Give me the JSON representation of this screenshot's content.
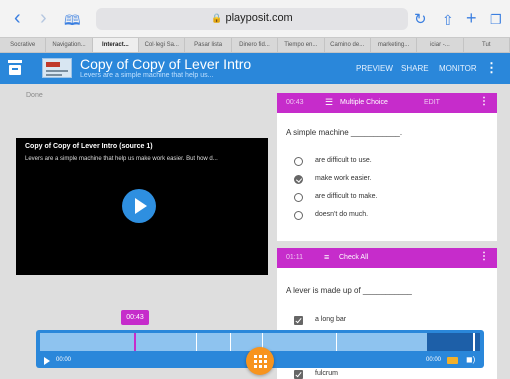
{
  "browser": {
    "url": "playposit.com",
    "tabs": [
      {
        "label": "Socrative",
        "active": false
      },
      {
        "label": "Navigation...",
        "active": false
      },
      {
        "label": "Interact...",
        "active": true
      },
      {
        "label": "Col·legi Sa...",
        "active": false
      },
      {
        "label": "Pasar lista",
        "active": false
      },
      {
        "label": "Dinero fid...",
        "active": false
      },
      {
        "label": "Tiempo en...",
        "active": false
      },
      {
        "label": "Camino de...",
        "active": false
      },
      {
        "label": "marketing...",
        "active": false
      },
      {
        "label": "iciar -...",
        "active": false
      },
      {
        "label": "Tut",
        "active": false
      }
    ]
  },
  "header": {
    "title": "Copy of Copy of Lever Intro",
    "subtitle": "Levers are a simple machine that help us...",
    "preview": "PREVIEW",
    "share": "SHARE",
    "monitor": "MONITOR",
    "accent": "#2a87da"
  },
  "main": {
    "done_label": "Done"
  },
  "video": {
    "title": "Copy of Copy of Lever Intro (source 1)",
    "description": "Levers are a simple machine that help us make work easier. But how d..."
  },
  "question1": {
    "time": "00:43",
    "type": "Multiple Choice",
    "edit": "EDIT",
    "prompt": "A simple machine ___________.",
    "options": [
      {
        "label": "are difficult to use.",
        "selected": false
      },
      {
        "label": "make work easier.",
        "selected": true
      },
      {
        "label": "are difficult to make.",
        "selected": false
      },
      {
        "label": "doesn't do much.",
        "selected": false
      }
    ]
  },
  "question2": {
    "time": "01:11",
    "type": "Check All",
    "prompt": "A lever is made up of ___________",
    "options": [
      {
        "label": "a long bar",
        "checked": true
      },
      {
        "label": "fulcrum",
        "checked": true
      }
    ]
  },
  "timeline": {
    "marker_label": "00:43",
    "time_left": "00:00",
    "time_right": "00:00",
    "marker_color": "#c62ccb",
    "fab_color": "#f7941e"
  }
}
